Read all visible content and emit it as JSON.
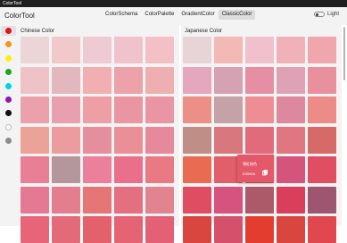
{
  "window": {
    "title": "ColorTool"
  },
  "app": {
    "title": "ColorTool"
  },
  "tabs": [
    {
      "label": "ColorSchema",
      "active": false
    },
    {
      "label": "ColorPalette",
      "active": false
    },
    {
      "label": "GradientColor",
      "active": false
    },
    {
      "label": "ClassicColor",
      "active": true
    }
  ],
  "theme_toggle": {
    "label": "Light",
    "on": false
  },
  "sidebar_colors": [
    "#e81123",
    "#f7941d",
    "#fff200",
    "#1ba81b",
    "#00d4e6",
    "#8a1bb0",
    "#111111",
    "#ffffff",
    "#8c8c8c"
  ],
  "chinese_panel": {
    "title": "Chinese Color",
    "swatches": [
      "#ecd5d6",
      "#f2c9cb",
      "#eecbd2",
      "#f0c3cc",
      "#f3c1c5",
      "#eec2c7",
      "#e2b7bd",
      "#f2afb1",
      "#eda1a8",
      "#eeafb1",
      "#eba1ab",
      "#e8a0b1",
      "#ed9fa5",
      "#ea96a2",
      "#e995a3",
      "#eba297",
      "#ec9c9f",
      "#e68f9c",
      "#eb8f97",
      "#e6899b",
      "#e97f94",
      "#b4969d",
      "#ec7f9b",
      "#ea6f8b",
      "#e97a83",
      "#e57994",
      "#e37e8f",
      "#e67575",
      "#e36f80",
      "#e18490",
      "#e86579",
      "#e36b79",
      "#e3616b",
      "#e56473",
      "#e26175"
    ]
  },
  "japanese_panel": {
    "title": "Japanese Color",
    "swatches": [
      "#e7d4d6",
      "#f3b9b5",
      "#f0c0cc",
      "#f0b2b8",
      "#efa7ad",
      "#e4a7bd",
      "#d4a2b2",
      "#e58ea4",
      "#dea1b6",
      "#e9909d",
      "#ec8f86",
      "#c5a1a8",
      "#ee8d93",
      "#dd889e",
      "#ec8b87",
      "#bf8e86",
      "#d8777d",
      "#e16b7a",
      "#e07682",
      "#d66a69",
      "#e96b52",
      "#e15f6a",
      "#e5586a",
      "#d4547b",
      "#e04e64",
      "#de4d61",
      "#d6527f",
      "#ac5a6a",
      "#d93e5a",
      "#9e5570",
      "#d9453f",
      "#d4506b",
      "#e33d30",
      "#d8463f",
      "#e1474f"
    ]
  },
  "popup": {
    "name": "薄紅梅色",
    "hex": "E5586A",
    "color": "#e5586a"
  }
}
